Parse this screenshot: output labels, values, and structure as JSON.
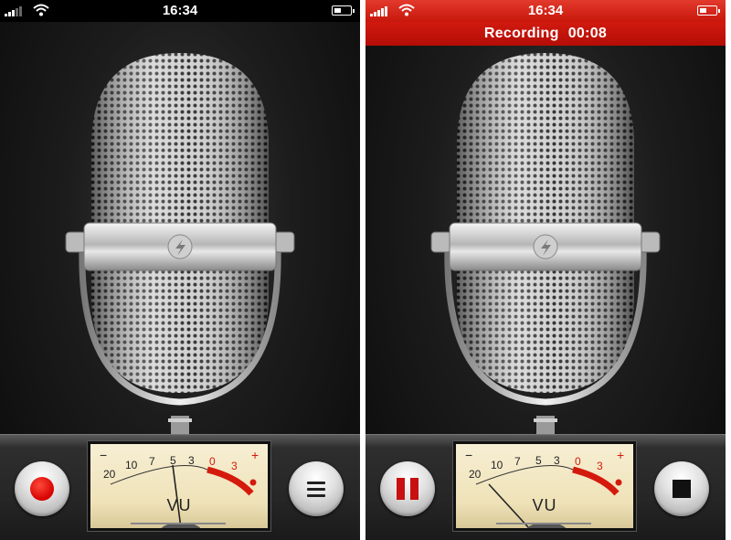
{
  "left_screen": {
    "status": {
      "time": "16:34"
    },
    "vu_meter": {
      "scale_labels": [
        "20",
        "10",
        "7",
        "5",
        "3",
        "0",
        "3"
      ],
      "minus_sign": "−",
      "plus_sign": "+",
      "unit_label": "VU",
      "needle_level": "≈ 5 (idle)"
    },
    "left_button_icon": "record-icon",
    "right_button_icon": "list-icon"
  },
  "right_screen": {
    "status": {
      "time": "16:34",
      "bar_color": "#d0190e"
    },
    "recording_banner": {
      "label": "Recording",
      "elapsed": "00:08"
    },
    "vu_meter": {
      "scale_labels": [
        "20",
        "10",
        "7",
        "5",
        "3",
        "0",
        "3"
      ],
      "minus_sign": "−",
      "plus_sign": "+",
      "unit_label": "VU",
      "needle_level": "≈ 20 (low)"
    },
    "left_button_icon": "pause-icon",
    "right_button_icon": "stop-icon"
  },
  "colors": {
    "record_red": "#d40000",
    "meter_face": "#f2e8c6",
    "red_zone": "#d41a0c"
  }
}
